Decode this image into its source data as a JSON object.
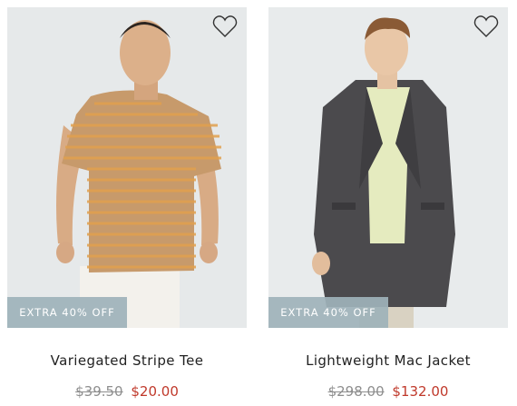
{
  "products": [
    {
      "name": "Variegated Stripe Tee",
      "promo": "EXTRA 40% OFF",
      "original_price": "$39.50",
      "sale_price": "$20.00",
      "favorite_icon": "heart-outline-icon"
    },
    {
      "name": "Lightweight Mac Jacket",
      "promo": "EXTRA 40% OFF",
      "original_price": "$298.00",
      "sale_price": "$132.00",
      "favorite_icon": "heart-outline-icon"
    }
  ],
  "colors": {
    "promo_badge": "#9eb2ba",
    "sale_price": "#c0392b",
    "original_price": "#8e8e8e"
  }
}
